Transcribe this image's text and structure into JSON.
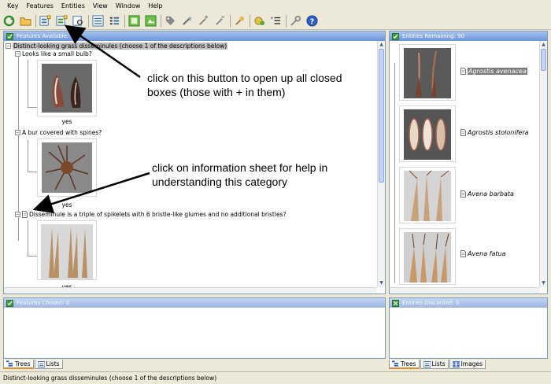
{
  "menu": [
    "Key",
    "Features",
    "Entities",
    "View",
    "Window",
    "Help"
  ],
  "toolbar_icons": [
    "refresh-icon",
    "open-folder-icon",
    "expand-all-icon",
    "open-boxes-icon",
    "find-icon",
    "list-view-icon",
    "tree-view-icon",
    "image-toggle-icon",
    "image-toggle-2-icon",
    "tag-icon",
    "wand-icon",
    "wand-plus-icon",
    "wand-minus-icon",
    "pin-icon",
    "coin-icon",
    "sort-icon",
    "key-icon",
    "help-icon"
  ],
  "features_available": {
    "title": "Features Available: 6",
    "root": "Distinct-looking grass disseminules (choose 1 of the descriptions below)",
    "items": [
      {
        "label": "Looks like a small bulb?",
        "value": "yes"
      },
      {
        "label": "A bur covered with spines?",
        "value": "yes"
      },
      {
        "label": "Disseminule is a triple of spikelets with 6 bristle-like glumes and no additional bristles?",
        "value": "yes"
      }
    ]
  },
  "annotations": {
    "first": "click on this button to open up all closed boxes (those with + in them)",
    "second": "click on information sheet for help in understanding this category"
  },
  "entities_remaining": {
    "title": "Entities Remaining: 90",
    "items": [
      "Agrostis avenacea",
      "Agrostis stolonifera",
      "Avena barbata",
      "Avena fatua"
    ]
  },
  "features_chosen": {
    "title": "Features Chosen: 0"
  },
  "entities_discarded": {
    "title": "Entities Discarded: 0"
  },
  "left_tabs": [
    "Trees",
    "Lists"
  ],
  "right_tabs": [
    "Trees",
    "Lists",
    "Images"
  ],
  "status": "Distinct-looking grass disseminules (choose 1 of the descriptions below)",
  "colors": {
    "header_blue": "#6c95dc",
    "selection_gray": "#7b7b7b",
    "tab_accent": "#e68b2c"
  }
}
